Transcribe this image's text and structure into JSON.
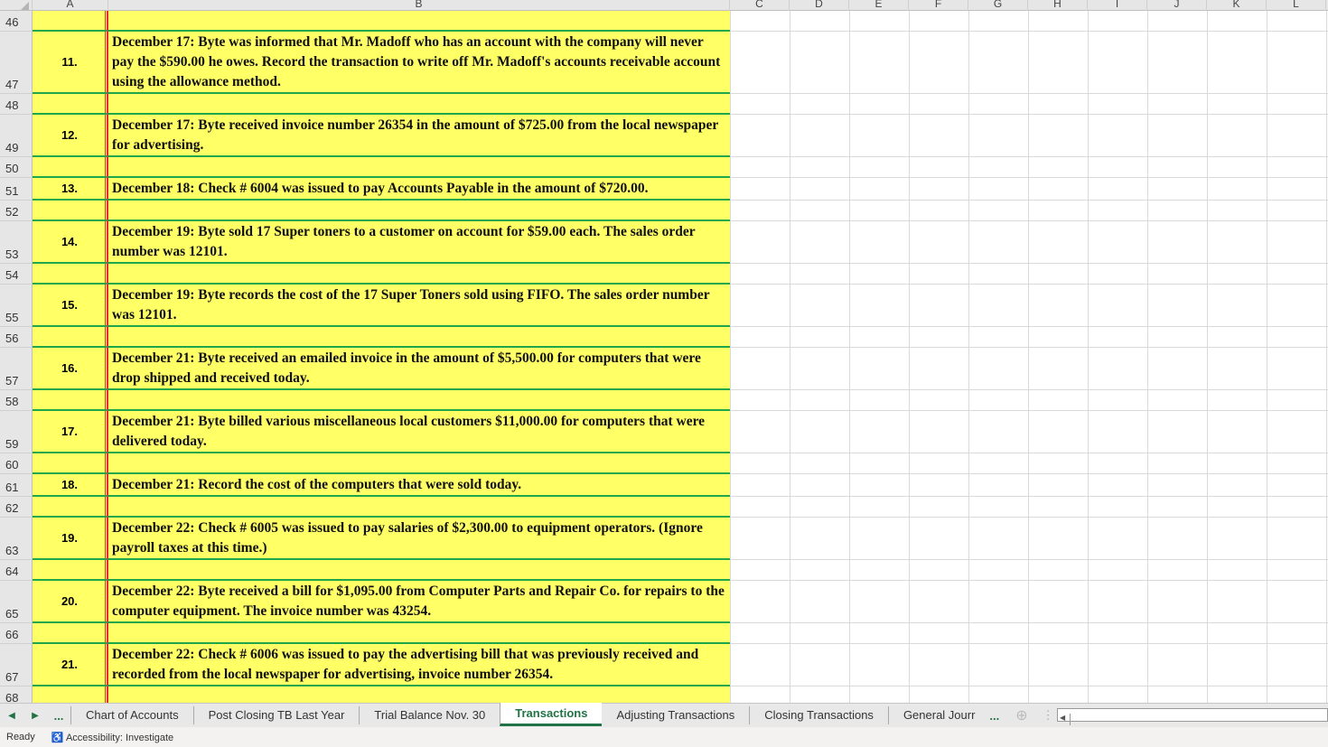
{
  "columns": [
    "A",
    "B",
    "C",
    "D",
    "E",
    "F",
    "G",
    "H",
    "I",
    "J",
    "K",
    "L"
  ],
  "rows": [
    {
      "row": "46",
      "num": "",
      "text": ""
    },
    {
      "row": "47",
      "num": "11.",
      "text": "December 17: Byte was informed that Mr. Madoff who has an account with the company will never pay the $590.00 he owes.  Record the transaction to write off Mr. Madoff's accounts receivable account using the allowance method."
    },
    {
      "row": "48",
      "num": "",
      "text": ""
    },
    {
      "row": "49",
      "num": "12.",
      "text": "December 17: Byte received invoice number 26354 in the amount of $725.00 from the local newspaper for advertising."
    },
    {
      "row": "50",
      "num": "",
      "text": ""
    },
    {
      "row": "51",
      "num": "13.",
      "text": "December 18: Check # 6004 was issued to pay Accounts Payable in the amount of $720.00."
    },
    {
      "row": "52",
      "num": "",
      "text": ""
    },
    {
      "row": "53",
      "num": "14.",
      "text": "December 19:  Byte sold 17 Super toners to a customer on account for $59.00 each. The sales order number was 12101."
    },
    {
      "row": "54",
      "num": "",
      "text": ""
    },
    {
      "row": "55",
      "num": "15.",
      "text": "December 19: Byte records the cost of the 17 Super Toners sold using FIFO. The sales order number was 12101."
    },
    {
      "row": "56",
      "num": "",
      "text": ""
    },
    {
      "row": "57",
      "num": "16.",
      "text": "December 21:  Byte received an emailed invoice in the amount of $5,500.00 for computers that were drop shipped and received today."
    },
    {
      "row": "58",
      "num": "",
      "text": ""
    },
    {
      "row": "59",
      "num": "17.",
      "text": "December 21:   Byte billed various miscellaneous local customers $11,000.00 for computers that were delivered today."
    },
    {
      "row": "60",
      "num": "",
      "text": ""
    },
    {
      "row": "61",
      "num": "18.",
      "text": "December 21:  Record the cost of the computers that were sold today."
    },
    {
      "row": "62",
      "num": "",
      "text": ""
    },
    {
      "row": "63",
      "num": "19.",
      "text": "December 22:   Check # 6005 was issued to pay salaries of $2,300.00 to equipment operators. (Ignore payroll taxes at this time.)"
    },
    {
      "row": "64",
      "num": "",
      "text": ""
    },
    {
      "row": "65",
      "num": "20.",
      "text": "December 22:   Byte received a bill for $1,095.00 from Computer Parts and Repair Co. for repairs to the computer equipment.  The invoice number was 43254."
    },
    {
      "row": "66",
      "num": "",
      "text": ""
    },
    {
      "row": "67",
      "num": "21.",
      "text": "December 22:   Check # 6006 was issued to pay the advertising bill that was previously received and recorded from the local newspaper for advertising, invoice number 26354."
    },
    {
      "row": "68",
      "num": "",
      "text": ""
    },
    {
      "row": "",
      "num": "",
      "text": ""
    }
  ],
  "tabs": {
    "more": "...",
    "items": [
      "Chart of Accounts",
      "Post Closing TB Last Year",
      "Trial Balance Nov. 30",
      "Transactions",
      "Adjusting Transactions",
      "Closing Transactions",
      "General Jourr"
    ],
    "active": "Transactions",
    "overflow": "..."
  },
  "status": {
    "ready": "Ready",
    "accessibility": "Accessibility: Investigate"
  }
}
